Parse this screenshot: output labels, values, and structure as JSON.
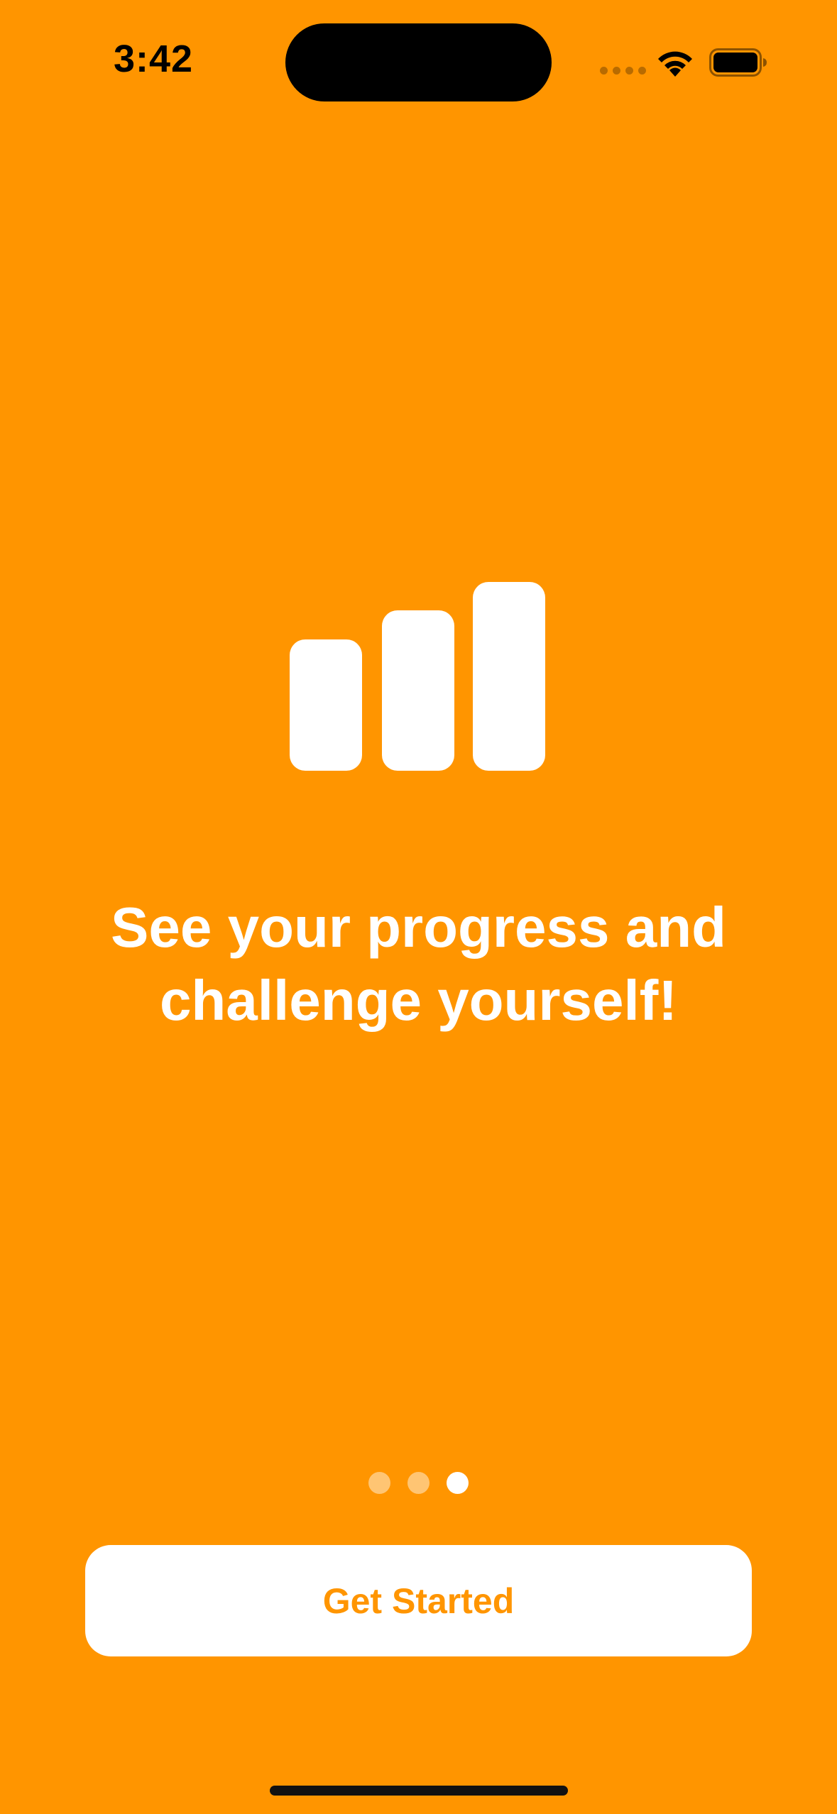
{
  "status_bar": {
    "time": "3:42",
    "icons": [
      "cellular-dots-icon",
      "wifi-icon",
      "battery-icon"
    ]
  },
  "onboarding": {
    "hero_icon": "chart-bar-icon",
    "headline": "See your progress and\nchallenge yourself!",
    "page_indicator": {
      "total": 3,
      "current": 3
    },
    "primary_button_label": "Get Started"
  },
  "colors": {
    "background": "#FF9500",
    "accent": "#FF9500",
    "button_background": "#FFFFFF",
    "text_primary": "#FFFFFF"
  }
}
